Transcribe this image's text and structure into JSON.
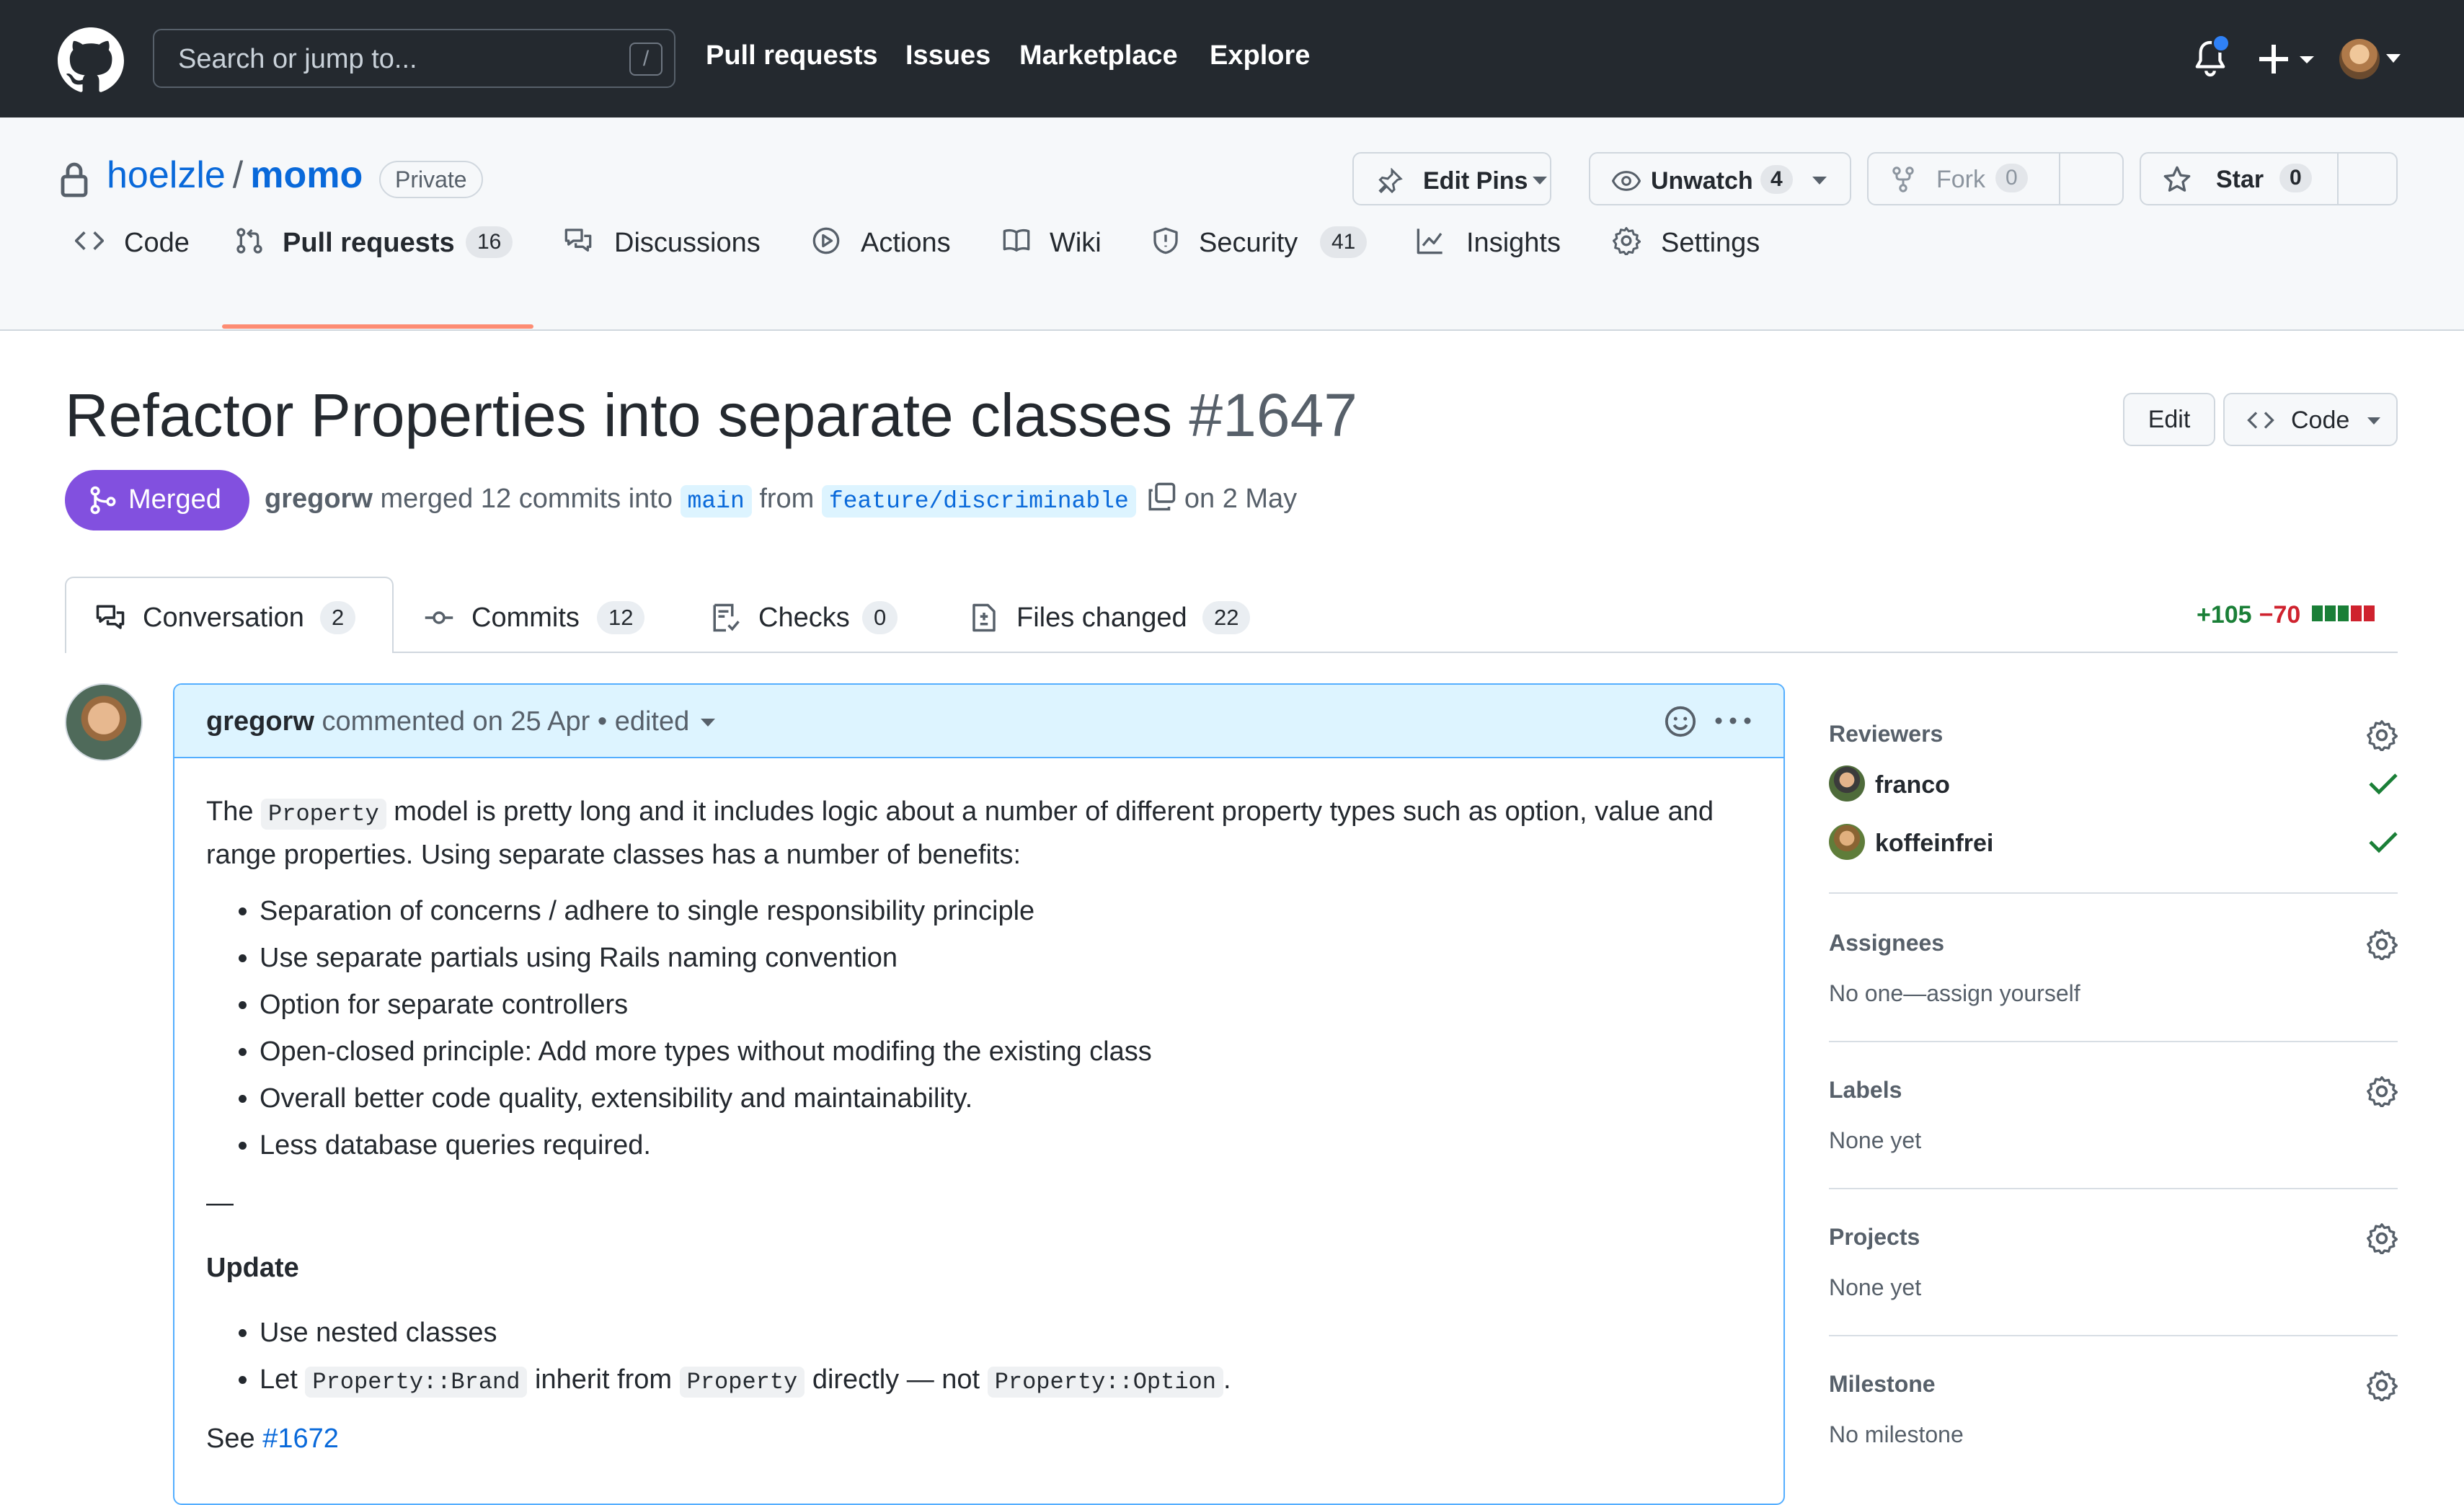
{
  "topnav": {
    "search_placeholder": "Search or jump to...",
    "search_shortcut": "/",
    "links": [
      "Pull requests",
      "Issues",
      "Marketplace",
      "Explore"
    ]
  },
  "repo": {
    "owner": "hoelzle",
    "separator": "/",
    "name": "momo",
    "visibility": "Private",
    "buttons": {
      "edit_pins": "Edit Pins",
      "unwatch": "Unwatch",
      "unwatch_count": "4",
      "fork": "Fork",
      "fork_count": "0",
      "star": "Star",
      "star_count": "0"
    },
    "tabs": [
      {
        "label": "Code",
        "count": ""
      },
      {
        "label": "Pull requests",
        "count": "16"
      },
      {
        "label": "Discussions",
        "count": ""
      },
      {
        "label": "Actions",
        "count": ""
      },
      {
        "label": "Wiki",
        "count": ""
      },
      {
        "label": "Security",
        "count": "41"
      },
      {
        "label": "Insights",
        "count": ""
      },
      {
        "label": "Settings",
        "count": ""
      }
    ]
  },
  "pr": {
    "title": "Refactor Properties into separate classes",
    "number": "#1647",
    "edit_label": "Edit",
    "code_label": "Code",
    "state": "Merged",
    "merged_by": "gregorw",
    "merged_text": "merged 12 commits into",
    "base_branch": "main",
    "from_text": "from",
    "head_branch": "feature/discriminable",
    "date_text": "on 2 May",
    "tabs": [
      {
        "label": "Conversation",
        "count": "2"
      },
      {
        "label": "Commits",
        "count": "12"
      },
      {
        "label": "Checks",
        "count": "0"
      },
      {
        "label": "Files changed",
        "count": "22"
      }
    ],
    "additions": "+105",
    "deletions": "−70",
    "diff_blocks": [
      "add",
      "add",
      "add",
      "del",
      "del"
    ]
  },
  "comment": {
    "author": "gregorw",
    "action": "commented on 25 Apr",
    "bullet_sep": "•",
    "edited": "edited",
    "intro_prefix": "The",
    "intro_code": "Property",
    "intro_rest": "model is pretty long and it includes logic about a number of different property types such as option, value and range properties. Using separate classes has a number of benefits:",
    "benefits": [
      "Separation of concerns / adhere to single responsibility principle",
      "Use separate partials using Rails naming convention",
      "Option for separate controllers",
      "Open-closed principle: Add more types without modifing the existing class",
      "Overall better code quality, extensibility and maintainability.",
      "Less database queries required."
    ],
    "dash": "—",
    "update_heading": "Update",
    "update_item1": "Use nested classes",
    "update_item2": {
      "t1": "Let",
      "c1": "Property::Brand",
      "t2": "inherit from",
      "c2": "Property",
      "t3": "directly — not",
      "c3": "Property::Option",
      "t4": "."
    },
    "see_prefix": "See",
    "see_link": "#1672"
  },
  "sidebar": {
    "reviewers_title": "Reviewers",
    "reviewers": [
      {
        "name": "franco"
      },
      {
        "name": "koffeinfrei"
      }
    ],
    "assignees_title": "Assignees",
    "assignees_text": "No one—assign yourself",
    "labels_title": "Labels",
    "labels_text": "None yet",
    "projects_title": "Projects",
    "projects_text": "None yet",
    "milestone_title": "Milestone",
    "milestone_text": "No milestone"
  },
  "colors": {
    "nav_bg": "#24292f",
    "link": "#0969da",
    "merged": "#8250df",
    "add": "#1a7f37",
    "del": "#cf222e",
    "tab_underline": "#fd8c73"
  }
}
